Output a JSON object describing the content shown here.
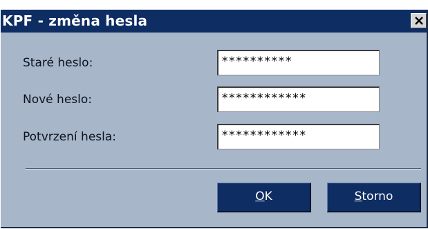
{
  "window": {
    "title": "KPF - změna hesla",
    "close_icon": "close-x-icon"
  },
  "form": {
    "old_password": {
      "label": "Staré heslo:",
      "value": "**********"
    },
    "new_password": {
      "label": "Nové heslo:",
      "value": "************"
    },
    "confirm_password": {
      "label": "Potvrzení hesla:",
      "value": "************"
    }
  },
  "buttons": {
    "ok": {
      "accel": "O",
      "rest": "K"
    },
    "cancel": {
      "accel": "S",
      "rest": "torno"
    }
  },
  "colors": {
    "titlebar": "#0e2d63",
    "dialog_bg": "#a7b6c9",
    "button_bg": "#0e2d63"
  }
}
